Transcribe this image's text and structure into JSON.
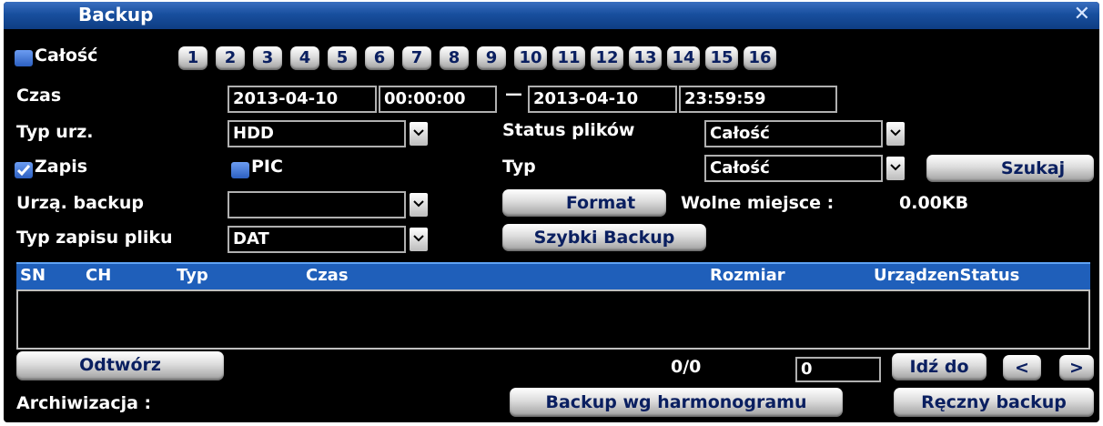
{
  "window": {
    "title": "Backup",
    "close_icon": "close-icon"
  },
  "channels": {
    "all_label": "Całość",
    "all_checked": false,
    "items": [
      "1",
      "2",
      "3",
      "4",
      "5",
      "6",
      "7",
      "8",
      "9",
      "10",
      "11",
      "12",
      "13",
      "14",
      "15",
      "16"
    ]
  },
  "time": {
    "label": "Czas",
    "start_date": "2013-04-10",
    "start_time": "00:00:00",
    "separator": "—",
    "end_date": "2013-04-10",
    "end_time": "23:59:59"
  },
  "device_type": {
    "label": "Typ urz.",
    "value": "HDD"
  },
  "file_status": {
    "label": "Status plików",
    "value": "Całość"
  },
  "record": {
    "label": "Zapis",
    "checked": true
  },
  "pic": {
    "label": "PIC",
    "checked": false
  },
  "type": {
    "label": "Typ",
    "value": "Całość"
  },
  "search_button": "Szukaj",
  "backup_device": {
    "label": "Urzą. backup",
    "value": ""
  },
  "format_button": "Format",
  "free_space": {
    "label": "Wolne miejsce :",
    "value": "0.00KB"
  },
  "file_record_type": {
    "label": "Typ zapisu pliku",
    "value": "DAT"
  },
  "quick_backup_button": "Szybki Backup",
  "table": {
    "columns": [
      "SN",
      "CH",
      "Typ",
      "Czas",
      "Rozmiar",
      "UrządzenStatus"
    ],
    "rows": []
  },
  "play_button": "Odtwórz",
  "pagination": {
    "count": "0/0",
    "page_input": "0",
    "goto_button": "Idź do",
    "prev": "<",
    "next": ">"
  },
  "archive": {
    "label": "Archiwizacja :"
  },
  "schedule_backup_button": "Backup wg harmonogramu",
  "manual_backup_button": "Ręczny backup",
  "colors": {
    "title_bar": "#184f9e",
    "header_row": "#1f5fba",
    "background": "#000000"
  }
}
